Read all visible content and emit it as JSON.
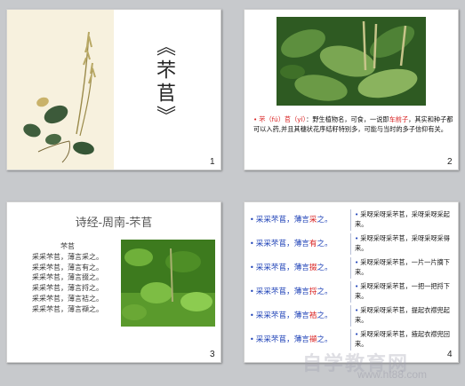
{
  "slides": [
    {
      "number": "1",
      "title": "《芣苢》"
    },
    {
      "number": "2",
      "note_parts": {
        "p1": "芣（fú）",
        "p2": "苢（yǐ）",
        "p3": "：野生植物名，可食，一说即",
        "p4": "车前子",
        "p5": "，其实和种子都可以入药,并且其穗状花序结籽特别多，可能与当时的多子信仰有关。"
      }
    },
    {
      "number": "3",
      "title": "诗经-周南-芣苢",
      "poem": [
        "芣苢",
        "采采芣苢，薄言采之。",
        "采采芣苢，薄言有之。",
        "采采芣苢，薄言掇之。",
        "采采芣苢，薄言捋之。",
        "采采芣苢，薄言袺之。",
        "采采芣苢，薄言襭之。"
      ]
    },
    {
      "number": "4",
      "rows": [
        {
          "pre": "采采芣苢，薄言",
          "verb": "采",
          "post": "之。",
          "trans": "采呀采呀采芣苢，采呀采呀采起来。"
        },
        {
          "pre": "采采芣苢，薄言",
          "verb": "有",
          "post": "之。",
          "trans": "采呀采呀采芣苢，采呀采呀采得来。"
        },
        {
          "pre": "采采芣苢，薄言",
          "verb": "掇",
          "post": "之。",
          "trans": "采呀采呀采芣苢，一片一片摘下来。"
        },
        {
          "pre": "采采芣苢，薄言",
          "verb": "捋",
          "post": "之。",
          "trans": "采呀采呀采芣苢，一把一把捋下来。"
        },
        {
          "pre": "采采芣苢，薄言",
          "verb": "袺",
          "post": "之。",
          "trans": "采呀采呀采芣苢，提起衣襟兜起来。"
        },
        {
          "pre": "采采芣苢，薄言",
          "verb": "襭",
          "post": "之。",
          "trans": "采呀采呀采芣苢，掖起衣襟兜回来。"
        }
      ]
    }
  ],
  "watermark": {
    "text": "自学教育网",
    "url": "www.ht88.com"
  }
}
